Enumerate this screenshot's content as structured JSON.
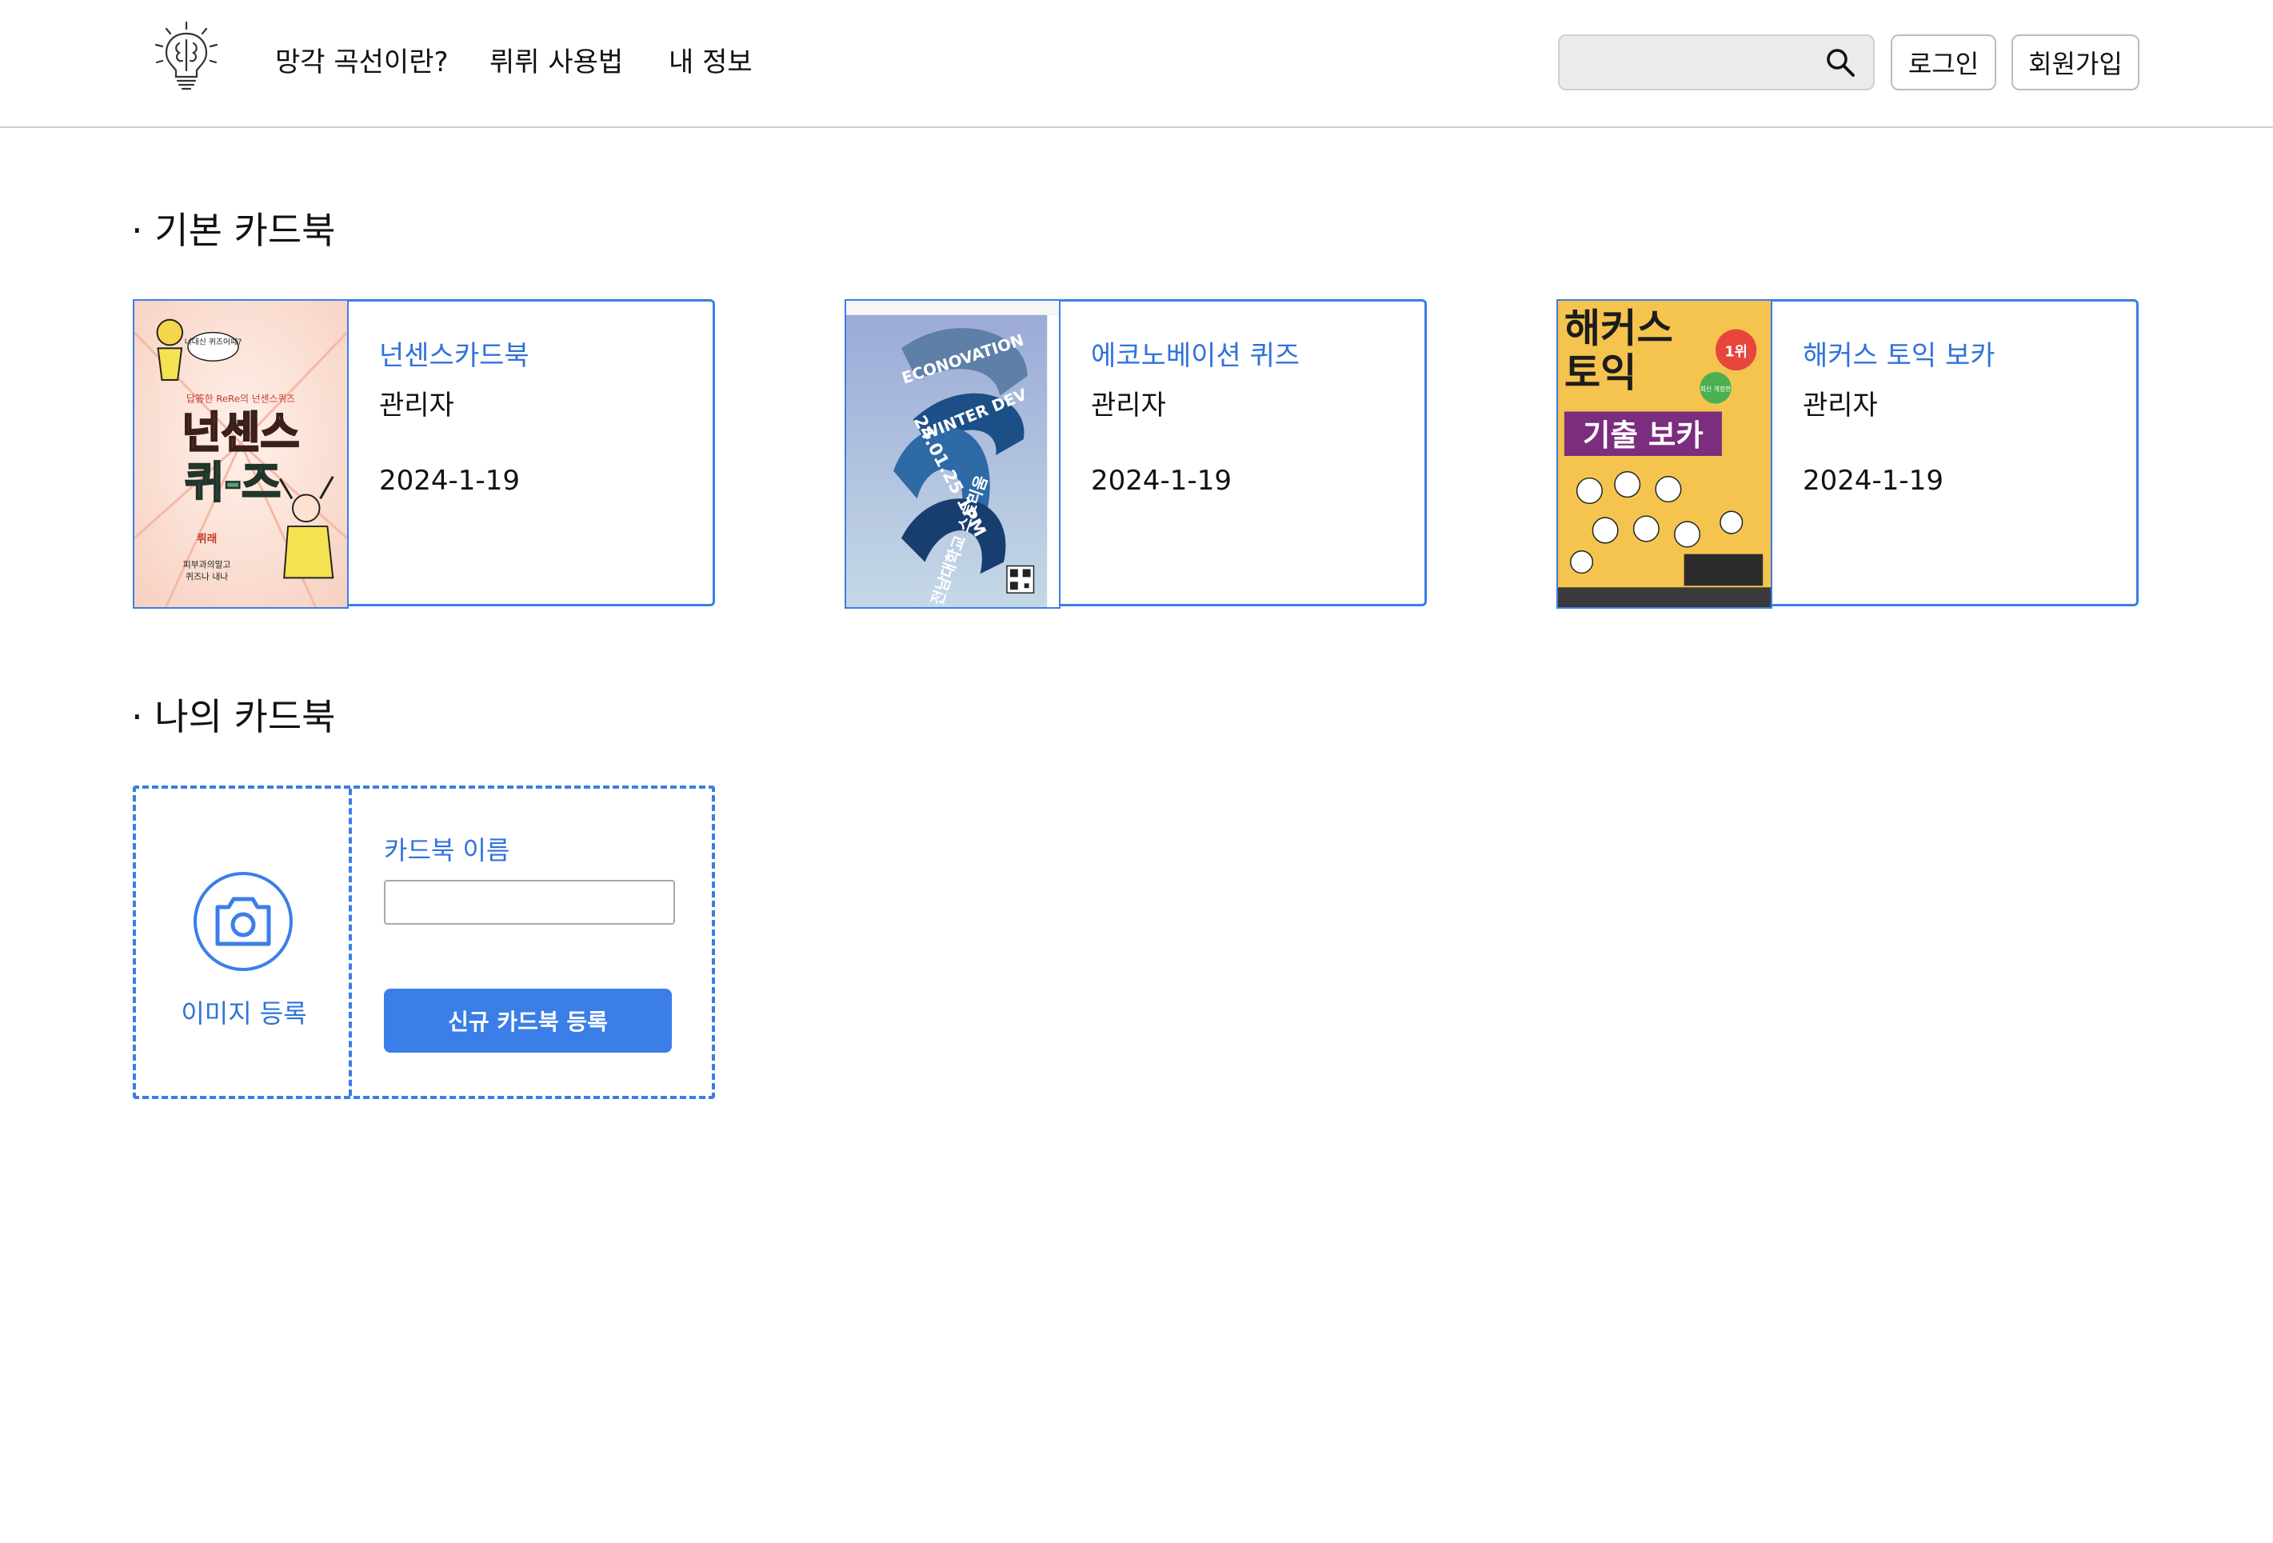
{
  "header": {
    "logo_icon": "lightbulb-brain-icon",
    "nav": [
      {
        "label": "망각 곡선이란?"
      },
      {
        "label": "뤼뤼 사용법"
      },
      {
        "label": "내 정보"
      }
    ],
    "search": {
      "value": "",
      "placeholder": "",
      "icon": "search-icon"
    },
    "login_label": "로그인",
    "signup_label": "회원가입"
  },
  "sections": {
    "basic_title": "· 기본 카드북",
    "mine_title": "· 나의 카드북"
  },
  "basic_cardbooks": [
    {
      "title": "넌센스카드북",
      "owner": "관리자",
      "date": "2024-1-19",
      "cover_text": {
        "bubble": "너대신 퀴즈어때?",
        "tagline": "답答한 ReRe의 넌센스퀴즈",
        "title_line1": "넌센스",
        "title_line2": "퀴-즈",
        "brand": "뤼래",
        "footer_line1": "피부과의말고",
        "footer_line2": "퀴즈나 내나"
      }
    },
    {
      "title": "에코노베이션 퀴즈",
      "owner": "관리자",
      "date": "2024-1-19",
      "cover_text": {
        "band1": "ECONOVATION",
        "band2": "WINTER DEV",
        "band3": "24.01.25 1PM",
        "band4": "전남대학교 스토리움"
      }
    },
    {
      "title": "해커스 토익 보카",
      "owner": "관리자",
      "date": "2024-1-19",
      "cover_text": {
        "title_line1": "해커스",
        "title_line2": "토익",
        "subtitle": "기출 보카",
        "badge": "1위",
        "badge2": "최신 개정판"
      }
    }
  ],
  "new_cardbook": {
    "image_label": "이미지 등록",
    "name_label": "카드북 이름",
    "name_value": "",
    "submit_label": "신규 카드북 등록"
  },
  "colors": {
    "accent": "#3b7ee8",
    "link": "#2f73d9",
    "search_bg": "#ebebeb"
  }
}
